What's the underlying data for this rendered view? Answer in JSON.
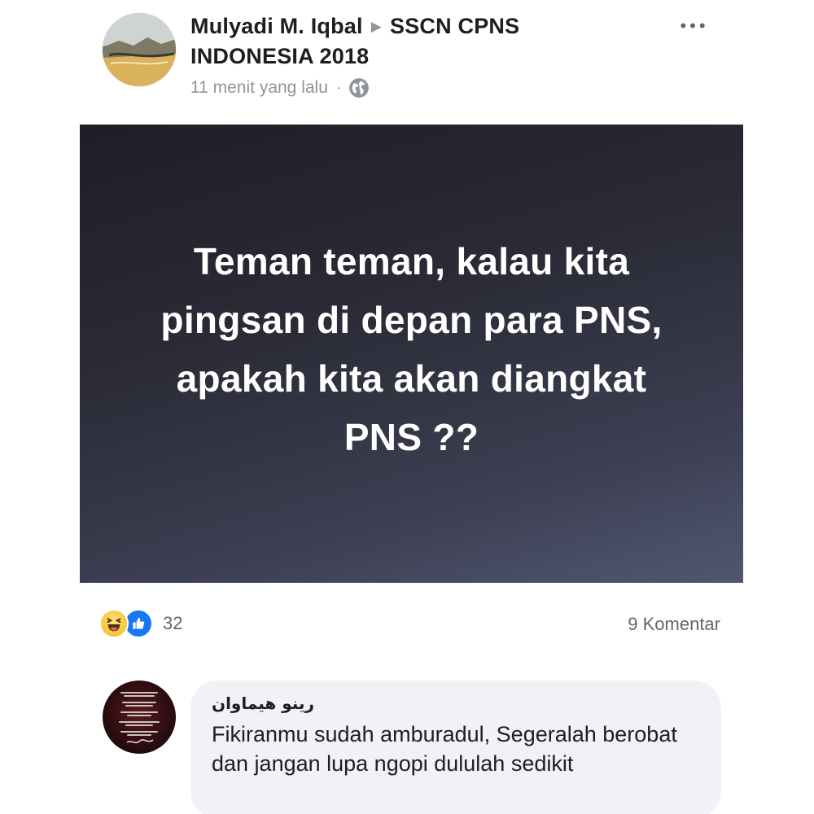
{
  "post": {
    "author": "Mulyadi M. Iqbal",
    "group_line1": "SSCN CPNS",
    "group_line2": "INDONESIA 2018",
    "arrow": "▶",
    "timestamp": "11 menit yang lalu",
    "separator": "·",
    "privacy_icon": "globe-icon",
    "more_label": "•••",
    "card_text": "Teman teman, kalau kita pingsan di depan para PNS, apakah kita akan diangkat PNS ??",
    "card_colors": {
      "gradient_start": "#1e1e27",
      "gradient_end": "#515671",
      "text": "#ffffff"
    }
  },
  "reactions": {
    "icons": [
      "haha-reaction-icon",
      "like-reaction-icon"
    ],
    "count": "32",
    "comments_label": "9 Komentar"
  },
  "comment": {
    "author": "رينو هيماوان",
    "text": "Fikiranmu sudah amburadul, Segeralah berobat dan jangan lupa ngopi dululah sedikit"
  },
  "colors": {
    "primary_text": "#1c1e21",
    "secondary_text": "#606770",
    "meta_text": "#90949c",
    "like_blue": "#1877f2",
    "bubble_bg": "#f0f2f5"
  }
}
